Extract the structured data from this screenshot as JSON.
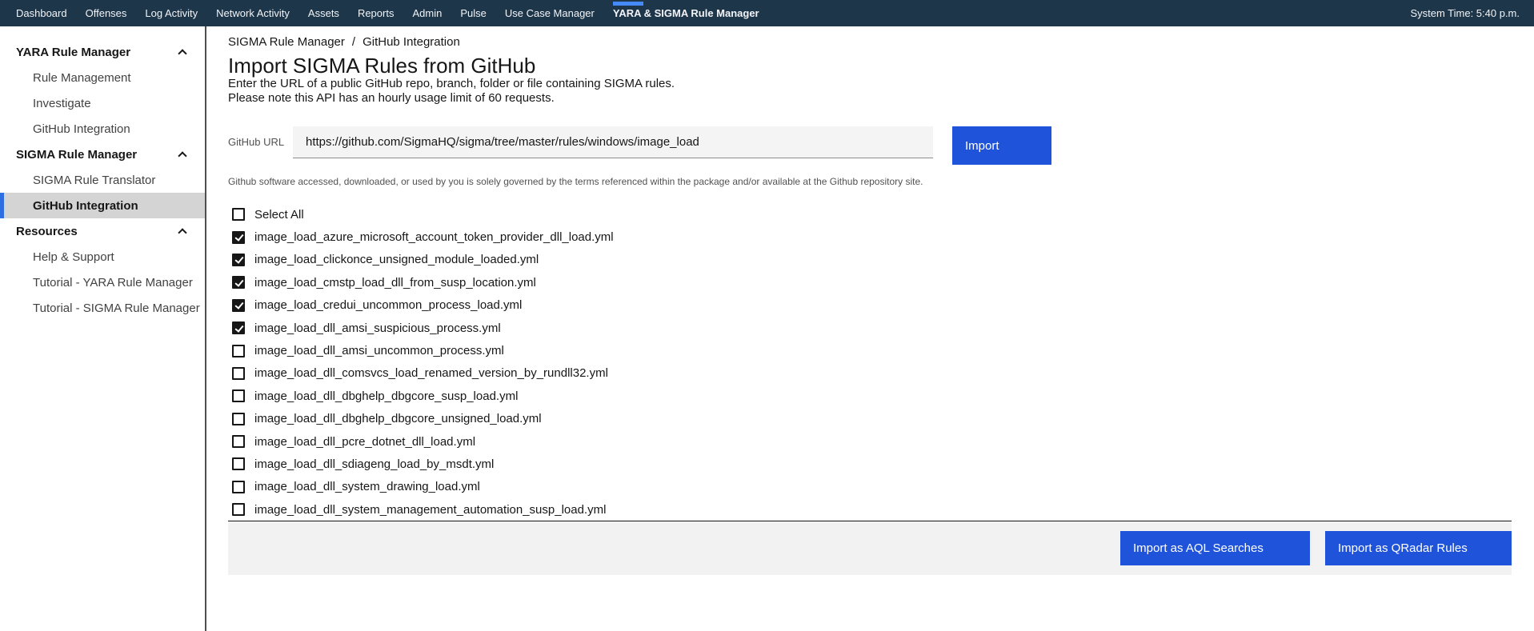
{
  "colors": {
    "top_nav_bg": "#1d3649",
    "nav_active_indicator": "#4589ff",
    "primary_button": "#1e53da",
    "sidebar_active_bar": "#2d6ee0",
    "sidebar_active_bg": "#d4d4d4",
    "input_bg": "#f4f4f4",
    "footer_bg": "#f2f2f2"
  },
  "top_nav": {
    "items": [
      {
        "label": "Dashboard",
        "active": false
      },
      {
        "label": "Offenses",
        "active": false
      },
      {
        "label": "Log Activity",
        "active": false
      },
      {
        "label": "Network Activity",
        "active": false
      },
      {
        "label": "Assets",
        "active": false
      },
      {
        "label": "Reports",
        "active": false
      },
      {
        "label": "Admin",
        "active": false
      },
      {
        "label": "Pulse",
        "active": false
      },
      {
        "label": "Use Case Manager",
        "active": false
      },
      {
        "label": "YARA & SIGMA Rule Manager",
        "active": true
      }
    ],
    "system_time": "System Time: 5:40 p.m."
  },
  "sidebar": {
    "sections": [
      {
        "header": "YARA Rule Manager",
        "chevron": "chevron-up",
        "items": [
          {
            "label": "Rule Management",
            "active": false
          },
          {
            "label": "Investigate",
            "active": false
          },
          {
            "label": "GitHub Integration",
            "active": false
          }
        ]
      },
      {
        "header": "SIGMA Rule Manager",
        "chevron": "chevron-up",
        "items": [
          {
            "label": "SIGMA Rule Translator",
            "active": false
          },
          {
            "label": "GitHub Integration",
            "active": true
          }
        ]
      },
      {
        "header": "Resources",
        "chevron": "chevron-up",
        "items": [
          {
            "label": "Help & Support",
            "active": false
          },
          {
            "label": "Tutorial - YARA Rule Manager",
            "active": false
          },
          {
            "label": "Tutorial - SIGMA Rule Manager",
            "active": false
          }
        ]
      }
    ]
  },
  "breadcrumb": {
    "items": [
      "SIGMA Rule Manager",
      "GitHub Integration"
    ],
    "separator": "/"
  },
  "header": {
    "title": "Import SIGMA Rules from GitHub",
    "description_line1": "Enter the URL of a public GitHub repo, branch, folder or file containing SIGMA rules.",
    "description_line2": "Please note this API has an hourly usage limit of 60 requests."
  },
  "form": {
    "url_label": "GitHub URL",
    "url_value": "https://github.com/SigmaHQ/sigma/tree/master/rules/windows/image_load",
    "import_button_label": "Import",
    "disclaimer": "Github software accessed, downloaded, or used by you is solely governed by the terms referenced within the package and/or available at the Github repository site."
  },
  "file_list": {
    "select_all_label": "Select All",
    "select_all_checked": false,
    "files": [
      {
        "name": "image_load_azure_microsoft_account_token_provider_dll_load.yml",
        "checked": true
      },
      {
        "name": "image_load_clickonce_unsigned_module_loaded.yml",
        "checked": true
      },
      {
        "name": "image_load_cmstp_load_dll_from_susp_location.yml",
        "checked": true
      },
      {
        "name": "image_load_credui_uncommon_process_load.yml",
        "checked": true
      },
      {
        "name": "image_load_dll_amsi_suspicious_process.yml",
        "checked": true
      },
      {
        "name": "image_load_dll_amsi_uncommon_process.yml",
        "checked": false
      },
      {
        "name": "image_load_dll_comsvcs_load_renamed_version_by_rundll32.yml",
        "checked": false
      },
      {
        "name": "image_load_dll_dbghelp_dbgcore_susp_load.yml",
        "checked": false
      },
      {
        "name": "image_load_dll_dbghelp_dbgcore_unsigned_load.yml",
        "checked": false
      },
      {
        "name": "image_load_dll_pcre_dotnet_dll_load.yml",
        "checked": false
      },
      {
        "name": "image_load_dll_sdiageng_load_by_msdt.yml",
        "checked": false
      },
      {
        "name": "image_load_dll_system_drawing_load.yml",
        "checked": false
      },
      {
        "name": "image_load_dll_system_management_automation_susp_load.yml",
        "checked": false
      }
    ]
  },
  "footer": {
    "import_aql_label": "Import as AQL Searches",
    "import_qradar_label": "Import as QRadar Rules"
  }
}
